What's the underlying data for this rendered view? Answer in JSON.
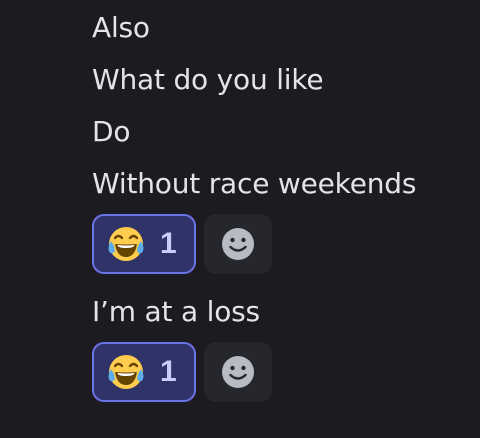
{
  "messages": [
    {
      "text": "Also"
    },
    {
      "text": "What do you like"
    },
    {
      "text": "Do"
    },
    {
      "text": "Without race weekends"
    },
    {
      "text": "I’m at a loss"
    }
  ],
  "reactions": [
    {
      "emoji": "face-with-tears-of-joy",
      "count": "1",
      "selected": true
    },
    {
      "emoji": "face-with-tears-of-joy",
      "count": "1",
      "selected": true
    }
  ],
  "icons": {
    "add_reaction": "smiley-face-icon"
  },
  "colors": {
    "background": "#1b1b20",
    "text": "#e3e4e8",
    "reaction_selected_bg": "#2f3368",
    "reaction_selected_border": "#6b74e6",
    "reaction_count": "#c9cdfb",
    "add_reaction_bg": "#26272d",
    "add_reaction_icon": "#b9bbc3"
  }
}
